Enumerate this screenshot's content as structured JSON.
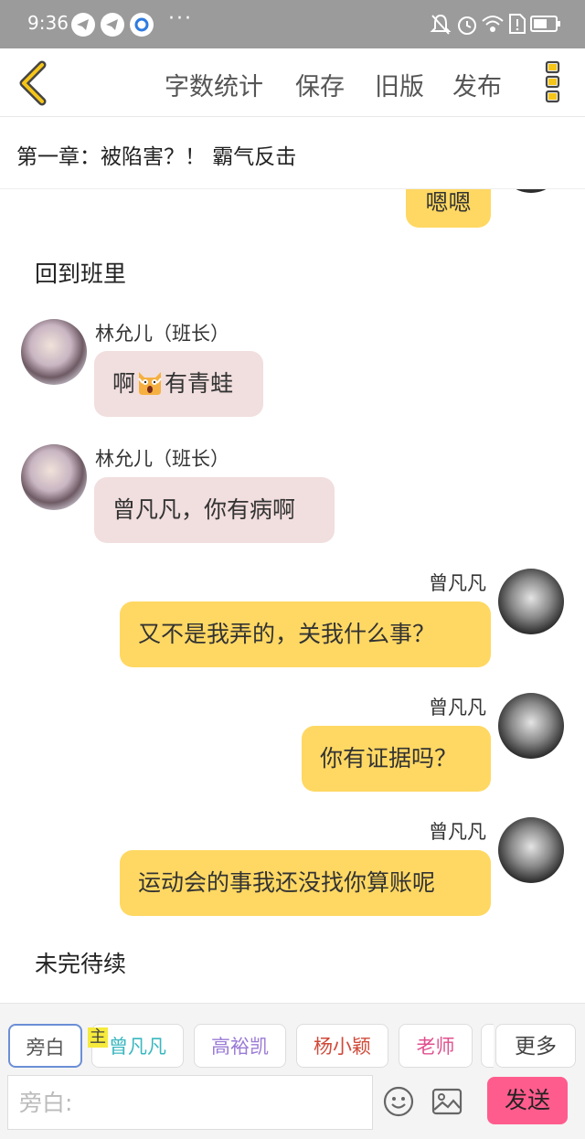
{
  "status_bar": {
    "time": "9:36",
    "dots": "···"
  },
  "header": {
    "buttons": [
      "字数统计",
      "保存",
      "旧版",
      "发布"
    ]
  },
  "chapter": {
    "title": "第一章：被陷害？！ 霸气反击"
  },
  "story": {
    "top_bubble": "嗯嗯",
    "narration_1": "回到班里",
    "msg1": {
      "name": "林允儿（班长）",
      "text_before": "啊",
      "text_after": "有青蛙"
    },
    "msg2": {
      "name": "林允儿（班长）",
      "text": "曾凡凡，你有病啊"
    },
    "msg3": {
      "name": "曾凡凡",
      "text": "又不是我弄的，关我什么事？"
    },
    "msg4": {
      "name": "曾凡凡",
      "text": "你有证据吗？"
    },
    "msg5": {
      "name": "曾凡凡",
      "text": "运动会的事我还没找你算账呢"
    },
    "narration_2": "未完待续"
  },
  "roles": {
    "narrator": "旁白",
    "main_tag": "主",
    "r1": "曾凡凡",
    "r2": "高裕凯",
    "r3": "杨小颖",
    "r4": "老师",
    "more": "更多"
  },
  "role_colors": {
    "r1": "#3ab7c0",
    "r2": "#9a7ad6",
    "r3": "#d04a3a",
    "r4": "#e0508f"
  },
  "input": {
    "placeholder": "旁白:",
    "send_label": "发送"
  }
}
